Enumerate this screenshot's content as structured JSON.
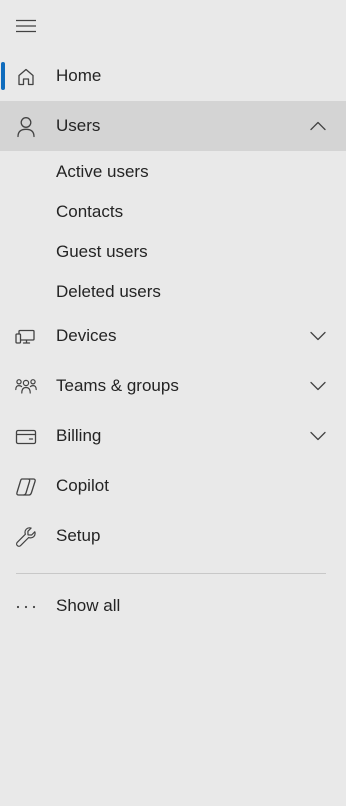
{
  "nav": {
    "menu_icon": "hamburger-icon",
    "items": [
      {
        "id": "home",
        "label": "Home",
        "icon": "home-icon",
        "selected": true
      },
      {
        "id": "users",
        "label": "Users",
        "icon": "person-icon",
        "expanded": true,
        "children": [
          "Active users",
          "Contacts",
          "Guest users",
          "Deleted users"
        ]
      },
      {
        "id": "devices",
        "label": "Devices",
        "icon": "devices-icon",
        "expandable": true
      },
      {
        "id": "teams-groups",
        "label": "Teams & groups",
        "icon": "people-team-icon",
        "expandable": true
      },
      {
        "id": "billing",
        "label": "Billing",
        "icon": "wallet-icon",
        "expandable": true
      },
      {
        "id": "copilot",
        "label": "Copilot",
        "icon": "copilot-icon"
      },
      {
        "id": "setup",
        "label": "Setup",
        "icon": "wrench-icon"
      }
    ],
    "show_all": {
      "label": "Show all",
      "icon": "more-horizontal-icon"
    }
  },
  "colors": {
    "background": "#e9e9e9",
    "expanded_background": "#d4d4d4",
    "selection_indicator": "#0f6cbd",
    "text": "#242424"
  }
}
